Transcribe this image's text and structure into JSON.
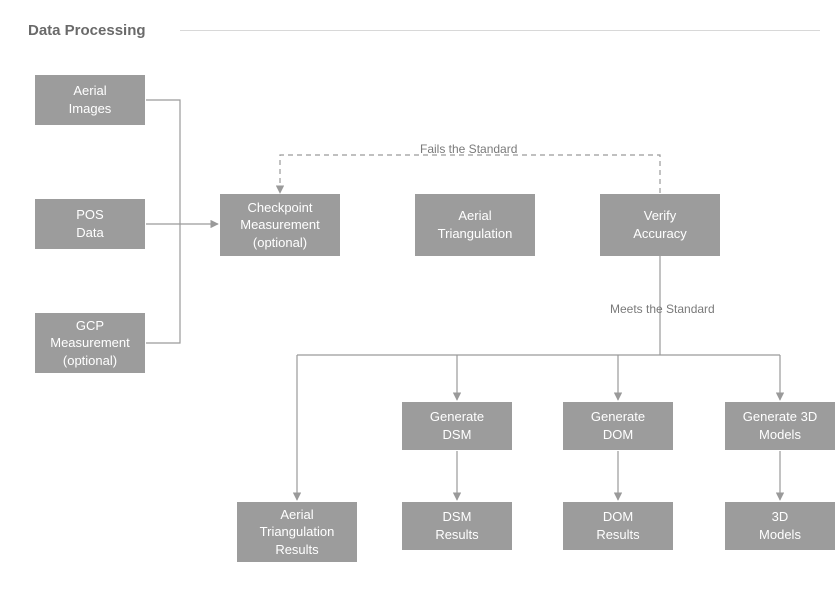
{
  "title": "Data Processing",
  "labels": {
    "fails": "Fails the Standard",
    "meets": "Meets the Standard"
  },
  "boxes": {
    "aerial_images": "Aerial\nImages",
    "pos_data": "POS\nData",
    "gcp_measurement": "GCP\nMeasurement\n(optional)",
    "checkpoint": "Checkpoint\nMeasurement\n(optional)",
    "aerial_triangulation": "Aerial\nTriangulation",
    "verify_accuracy": "Verify\nAccuracy",
    "generate_dsm": "Generate\nDSM",
    "generate_dom": "Generate\nDOM",
    "generate_3d": "Generate 3D\nModels",
    "at_results": "Aerial\nTriangulation\nResults",
    "dsm_results": "DSM\nResults",
    "dom_results": "DOM\nResults",
    "models_3d": "3D\nModels"
  }
}
